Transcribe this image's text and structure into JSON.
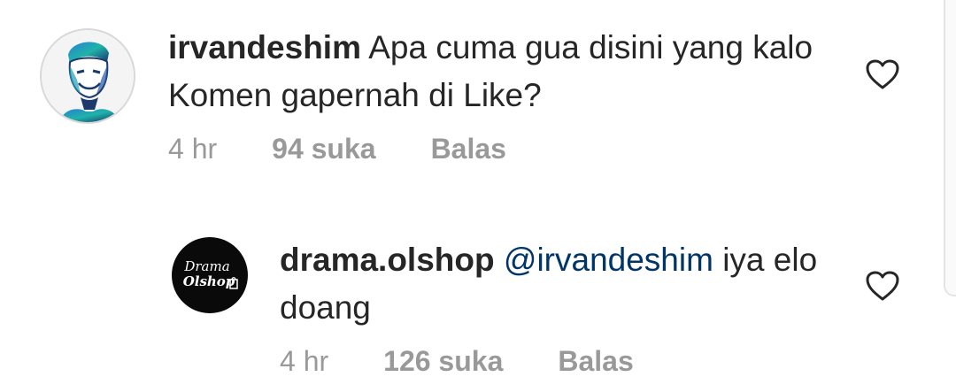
{
  "comments": [
    {
      "username": "irvandeshim",
      "text": "Apa cuma gua disini yang kalo Komen gapernah di Like?",
      "time": "4 hr",
      "likes": "94 suka",
      "reply": "Balas",
      "avatar_icon": "user-portrait-avatar",
      "like_icon": "heart-outline-icon"
    },
    {
      "username": "drama.olshop",
      "mention": "@irvandeshim",
      "text": "iya elo doang",
      "time": "4 hr",
      "likes": "126 suka",
      "reply": "Balas",
      "avatar_icon": "brand-logo-avatar",
      "avatar_logo_line1": "Drama",
      "avatar_logo_line2": "Olshop",
      "like_icon": "heart-outline-icon"
    }
  ],
  "colors": {
    "text": "#262626",
    "meta": "#999999",
    "mention": "#003569"
  }
}
